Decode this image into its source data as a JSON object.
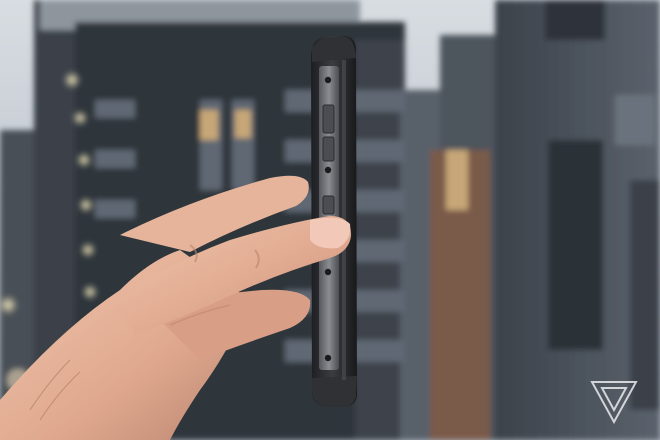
{
  "photo": {
    "subject": "side-of-rugged-phone",
    "background": "blurred-city-buildings-at-dusk"
  },
  "watermark": {
    "icon": "verge-logo-icon"
  },
  "palette": {
    "sky": "#c9cfd6",
    "building_dark": "#3a3f47",
    "building_right": "#4b525c",
    "phone_body": "#2b2d31",
    "phone_frame": "#6b6e73",
    "skin": "#e3b39a",
    "skin_shadow": "#b98470"
  }
}
